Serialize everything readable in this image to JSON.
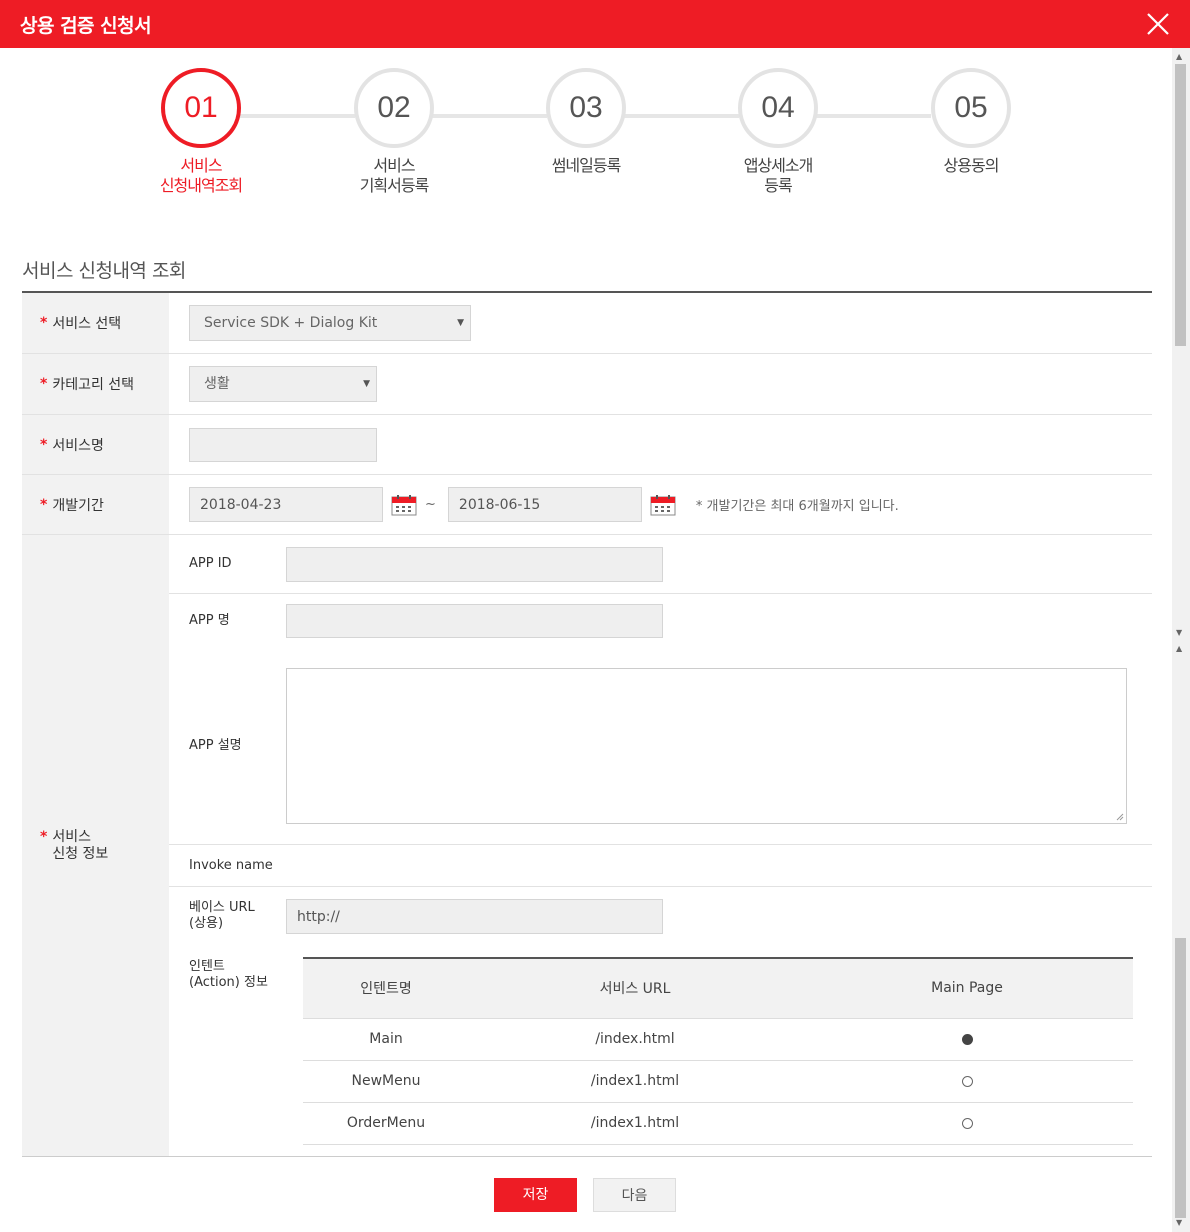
{
  "header": {
    "title": "상용 검증 신청서"
  },
  "steps": [
    {
      "num": "01",
      "label": "서비스\n신청내역조회",
      "active": true
    },
    {
      "num": "02",
      "label": "서비스\n기획서등록",
      "active": false
    },
    {
      "num": "03",
      "label": "썸네일등록",
      "active": false
    },
    {
      "num": "04",
      "label": "앱상세소개\n등록",
      "active": false
    },
    {
      "num": "05",
      "label": "상용동의",
      "active": false
    }
  ],
  "section_title": "서비스 신청내역 조회",
  "required_mark": "*",
  "form": {
    "service_select": {
      "label": "서비스 선택",
      "value": "Service SDK + Dialog Kit"
    },
    "category_select": {
      "label": "카테고리 선택",
      "value": "생활"
    },
    "service_name": {
      "label": "서비스명",
      "value": ""
    },
    "dev_period": {
      "label": "개발기간",
      "start": "2018-04-23",
      "separator": "~",
      "end": "2018-06-15",
      "note": "* 개발기간은 최대 6개월까지 입니다."
    },
    "service_info": {
      "label": "서비스\n신청 정보",
      "app_id": {
        "label": "APP ID",
        "value": ""
      },
      "app_name": {
        "label": "APP 명",
        "value": ""
      },
      "app_desc": {
        "label": "APP 설명",
        "value": ""
      },
      "invoke_name": {
        "label": "Invoke name"
      },
      "base_url": {
        "label": "베이스 URL\n(상용)",
        "value": "http://"
      },
      "intent": {
        "label": "인텐트\n(Action) 정보",
        "columns": [
          "인텐트명",
          "서비스 URL",
          "Main Page"
        ],
        "rows": [
          {
            "name": "Main",
            "url": "/index.html",
            "main": true
          },
          {
            "name": "NewMenu",
            "url": "/index1.html",
            "main": false
          },
          {
            "name": "OrderMenu",
            "url": "/index1.html",
            "main": false
          }
        ]
      }
    }
  },
  "buttons": {
    "save": "저장",
    "next": "다음"
  },
  "colors": {
    "accent": "#ee1c25",
    "label_bg": "#f2f2f2",
    "input_bg": "#efefef"
  },
  "icons": {
    "close": "close-icon",
    "calendar": "calendar-icon",
    "caret": "caret-down-icon",
    "radio_on": "radio-filled-icon",
    "radio_off": "radio-empty-icon"
  }
}
